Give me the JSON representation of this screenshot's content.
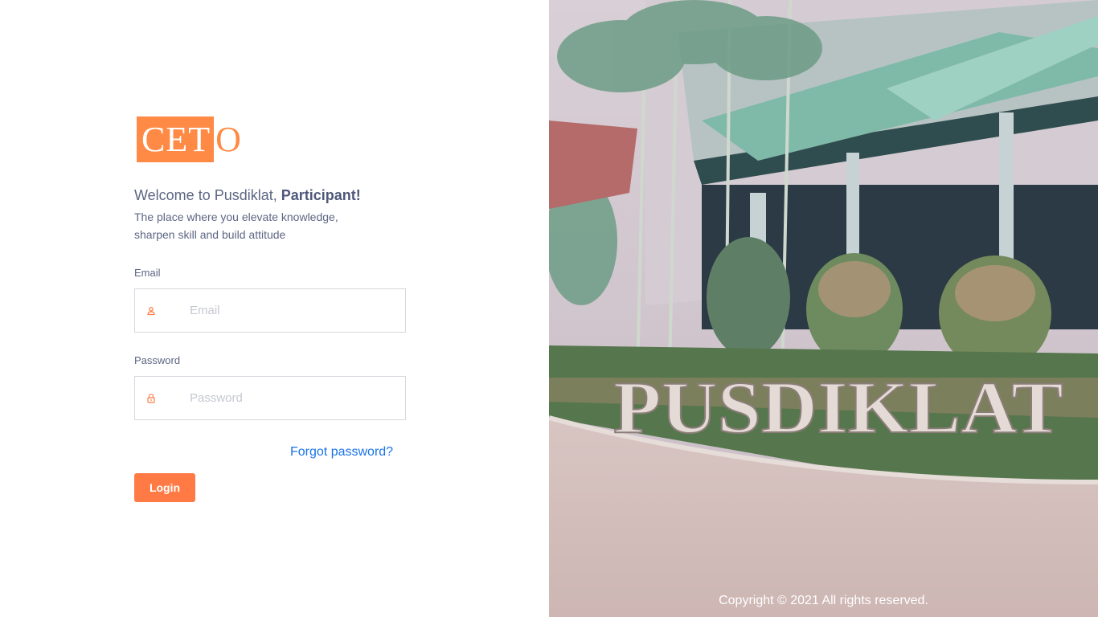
{
  "brand": {
    "logo_text": "CET",
    "logo_tail": "O",
    "accent": "#ff8a45"
  },
  "welcome": {
    "prefix": "Welcome to Pusdiklat, ",
    "role": "Participant!"
  },
  "tagline": {
    "line1": "The place where you elevate knowledge,",
    "line2": "sharpen skill and build attitude"
  },
  "form": {
    "email_label": "Email",
    "email_placeholder": "Email",
    "email_icon": "user-icon",
    "password_label": "Password",
    "password_placeholder": "Password",
    "password_icon": "lock-icon",
    "forgot": "Forgot password?",
    "login": "Login"
  },
  "hero": {
    "sign_text": "PUSDIKLAT",
    "copyright": "Copyright © 2021 All rights reserved."
  }
}
